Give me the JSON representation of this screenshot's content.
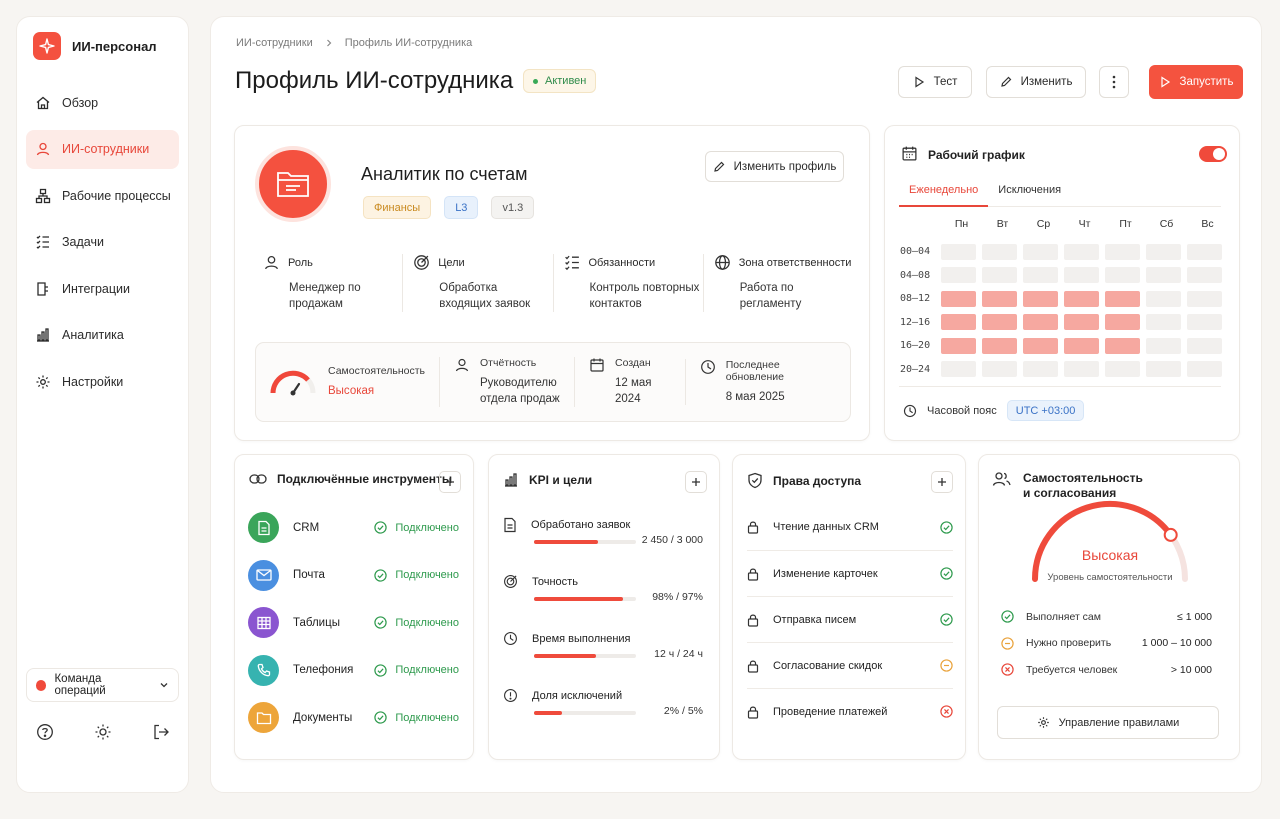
{
  "app": {
    "name": "ИИ-персонал",
    "accent": "#f4513f"
  },
  "sidebar": {
    "items": [
      {
        "label": "Обзор",
        "icon": "home-icon"
      },
      {
        "label": "ИИ-сотрудники",
        "icon": "user-icon",
        "active": true
      },
      {
        "label": "Рабочие процессы",
        "icon": "workflow-icon"
      },
      {
        "label": "Задачи",
        "icon": "tasks-icon"
      },
      {
        "label": "Интеграции",
        "icon": "plug-icon"
      },
      {
        "label": "Аналитика",
        "icon": "chart-icon"
      },
      {
        "label": "Настройки",
        "icon": "gear-icon"
      }
    ],
    "team": "Команда операций"
  },
  "header": {
    "breadcrumbs": [
      "ИИ-сотрудники",
      "Профиль ИИ-сотрудника"
    ],
    "title": "Профиль ИИ-сотрудника",
    "status": "Активен",
    "btn_test": "Тест",
    "btn_edit": "Изменить",
    "btn_run": "Запустить"
  },
  "profile": {
    "name": "Аналитик по счетам",
    "tags": [
      "Финансы",
      "L3",
      "v1.3"
    ],
    "edit_label": "Изменить профиль",
    "attrs": [
      {
        "title": "Роль",
        "value": "Менеджер по продажам"
      },
      {
        "title": "Цели",
        "value": "Обработка входящих заявок"
      },
      {
        "title": "Обязанности",
        "value": "Контроль повторных контактов"
      },
      {
        "title": "Зона ответственности",
        "value": "Работа по регламенту"
      }
    ],
    "autonomy_title": "Самостоятельность",
    "autonomy_value": "Высокая",
    "report_title": "Отчётность",
    "report_value": "Руководителю отдела продаж",
    "created_title": "Создан",
    "created_value": "12 мая 2024",
    "updated_title": "Последнее обновление",
    "updated_value": "8 мая 2025"
  },
  "schedule": {
    "title": "Рабочий график",
    "enabled": true,
    "tabs": [
      "Еженедельно",
      "Исключения"
    ],
    "days": [
      "Пн",
      "Вт",
      "Ср",
      "Чт",
      "Пт",
      "Сб",
      "Вс"
    ],
    "slots": [
      "00–04",
      "04–08",
      "08–12",
      "12–16",
      "16–20",
      "20–24"
    ],
    "active_slots": [
      "08–12",
      "12–16",
      "16–20"
    ],
    "active_days": [
      "Пн",
      "Вт",
      "Ср",
      "Чт",
      "Пт"
    ],
    "tz_label": "Часовой пояс",
    "tz_value": "UTC +03:00"
  },
  "tools": {
    "title": "Подключённые инструменты",
    "items": [
      {
        "name": "CRM",
        "status": "Подключено",
        "color": "#3aa55a"
      },
      {
        "name": "Почта",
        "status": "Подключено",
        "color": "#4a8fe0"
      },
      {
        "name": "Таблицы",
        "status": "Подключено",
        "color": "#8a55d0"
      },
      {
        "name": "Телефония",
        "status": "Подключено",
        "color": "#36b3b0"
      },
      {
        "name": "Документы",
        "status": "Подключено",
        "color": "#eda53a"
      }
    ]
  },
  "kpi": {
    "title": "KPI и цели",
    "items": [
      {
        "name": "Обработано заявок",
        "value": "2 450 / 3 000",
        "progress": 0.63
      },
      {
        "name": "Точность",
        "value": "98% / 97%",
        "progress": 0.87
      },
      {
        "name": "Время выполнения",
        "value": "12 ч / 24 ч",
        "progress": 0.61
      },
      {
        "name": "Доля исключений",
        "value": "2% / 5%",
        "progress": 0.27
      }
    ]
  },
  "access": {
    "title": "Права доступа",
    "items": [
      {
        "name": "Чтение данных CRM",
        "state": "ok"
      },
      {
        "name": "Изменение карточек",
        "state": "ok"
      },
      {
        "name": "Отправка писем",
        "state": "ok"
      },
      {
        "name": "Согласование скидок",
        "state": "review"
      },
      {
        "name": "Проведение платежей",
        "state": "denied"
      }
    ]
  },
  "autonomy": {
    "title_line1": "Самостоятельность",
    "title_line2": "и согласования",
    "level": "Высокая",
    "level_fraction": 0.8,
    "sub": "Уровень самостоятельности",
    "rules": [
      {
        "label": "Выполняет сам",
        "range": "≤ 1 000",
        "state": "ok"
      },
      {
        "label": "Нужно проверить",
        "range": "1 000 – 10 000",
        "state": "review"
      },
      {
        "label": "Требуется человек",
        "range": "> 10 000",
        "state": "denied"
      }
    ],
    "manage_label": "Управление правилами"
  }
}
